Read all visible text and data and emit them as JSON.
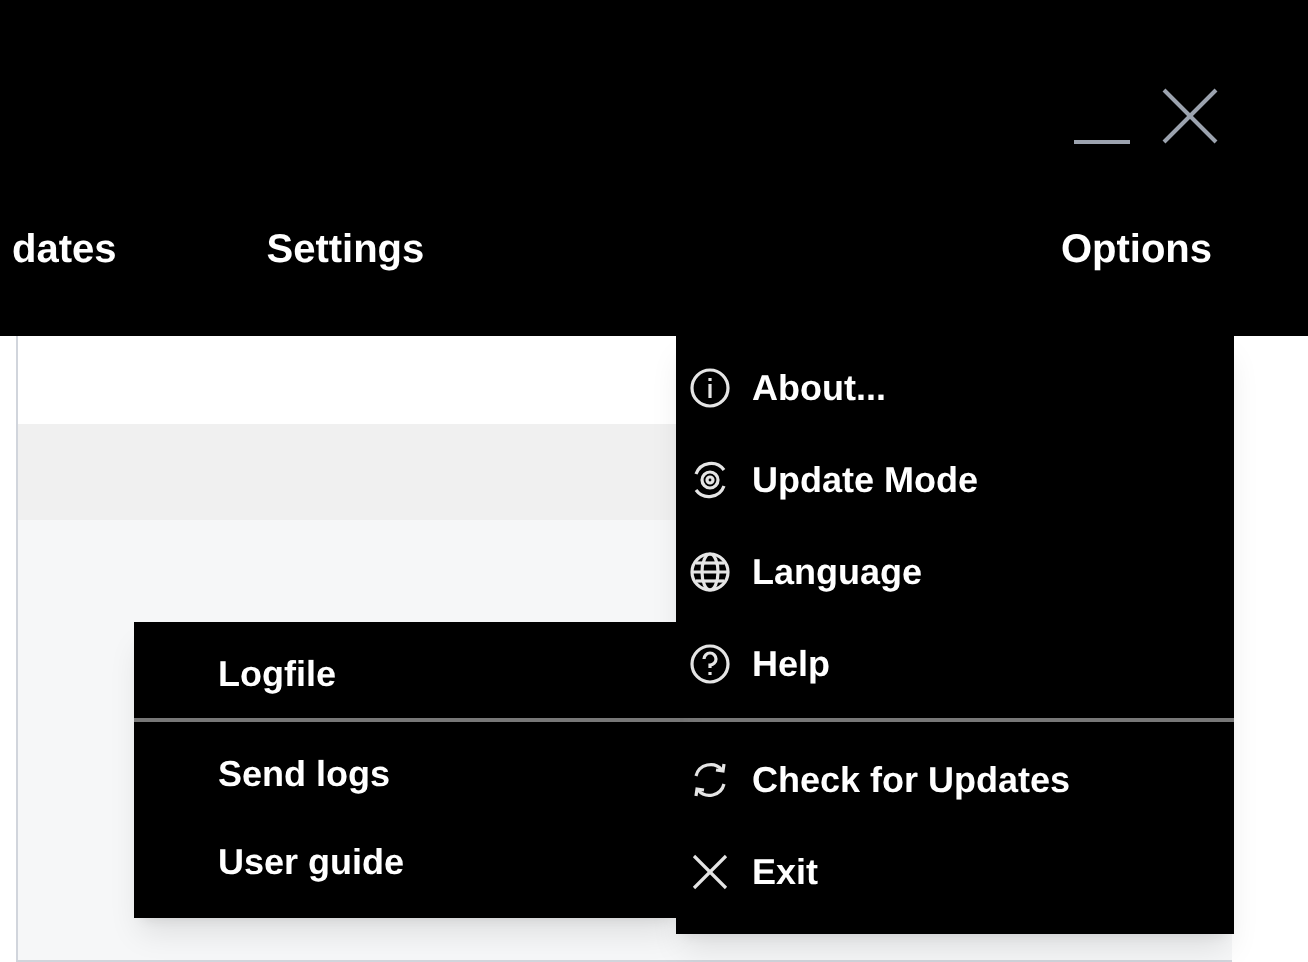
{
  "menu_bar": [
    {
      "label": "dates"
    },
    {
      "label": "Settings"
    },
    {
      "label": "Options"
    }
  ],
  "options_menu": {
    "groups": [
      [
        {
          "label": "About..."
        },
        {
          "label": "Update Mode"
        },
        {
          "label": "Language"
        },
        {
          "label": "Help"
        }
      ],
      [
        {
          "label": "Check for Updates"
        },
        {
          "label": "Exit"
        }
      ]
    ]
  },
  "help_submenu": {
    "groups": [
      [
        {
          "label": "Logfile"
        }
      ],
      [
        {
          "label": "Send logs"
        },
        {
          "label": "User guide"
        }
      ]
    ]
  }
}
